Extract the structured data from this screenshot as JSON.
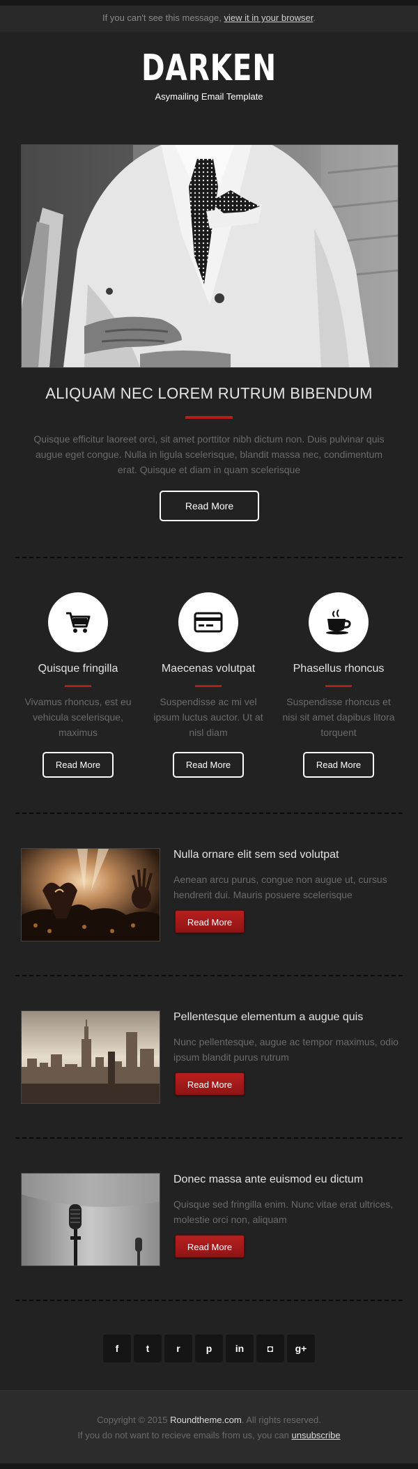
{
  "header": {
    "notice_prefix": "If you can't see this message,",
    "notice_link": "view it in your browser",
    "notice_suffix": ".",
    "logo": "DARKEN",
    "tagline": "Asymailing Email Template"
  },
  "hero": {
    "title": "ALIQUAM NEC LOREM RUTRUM BIBENDUM",
    "text": "Quisque efficitur laoreet orci, sit amet porttitor nibh dictum non. Duis pulvinar quis augue eget congue. Nulla in ligula scelerisque, blandit massa nec, condimentum erat. Quisque et diam in quam scelerisque",
    "button": "Read More"
  },
  "features": [
    {
      "icon": "cart-icon",
      "title": "Quisque fringilla",
      "text": "Vivamus rhoncus, est eu vehicula scelerisque, maximus",
      "button": "Read More"
    },
    {
      "icon": "credit-card-icon",
      "title": "Maecenas volutpat",
      "text": "Suspendisse ac mi vel ipsum luctus auctor. Ut at nisl diam",
      "button": "Read More"
    },
    {
      "icon": "coffee-cup-icon",
      "title": "Phasellus rhoncus",
      "text": "Suspendisse rhoncus et nisi sit amet dapibus litora torquent",
      "button": "Read More"
    }
  ],
  "articles": [
    {
      "title": "Nulla ornare elit sem sed volutpat",
      "text": "Aenean arcu purus, congue non augue ut, cursus hendrerit dui. Mauris posuere scelerisque",
      "button": "Read More"
    },
    {
      "title": "Pellentesque elementum a augue quis",
      "text": "Nunc pellentesque, augue ac tempor maximus, odio ipsum blandit purus rutrum",
      "button": "Read More"
    },
    {
      "title": "Donec massa ante euismod eu dictum",
      "text": "Quisque sed fringilla enim. Nunc vitae erat ultrices, molestie orci non, aliquam",
      "button": "Read More"
    }
  ],
  "social": [
    "facebook-icon",
    "twitter-icon",
    "rss-icon",
    "pinterest-icon",
    "linkedin-icon",
    "instagram-icon",
    "google-plus-icon"
  ],
  "social_glyphs": {
    "facebook": "f",
    "twitter": "t",
    "rss": "r",
    "pinterest": "p",
    "linkedin": "in",
    "instagram": "◘",
    "googleplus": "g+"
  },
  "footer": {
    "copyright_prefix": "Copyright © 2015",
    "brand": "Roundtheme.com",
    "copyright_suffix": ". All rights reserved.",
    "unsubscribe_prefix": "If you do not want to recieve emails from us, you can",
    "unsubscribe_link": "unsubscribe"
  },
  "colors": {
    "accent": "#b21d1d",
    "background": "#222222"
  }
}
